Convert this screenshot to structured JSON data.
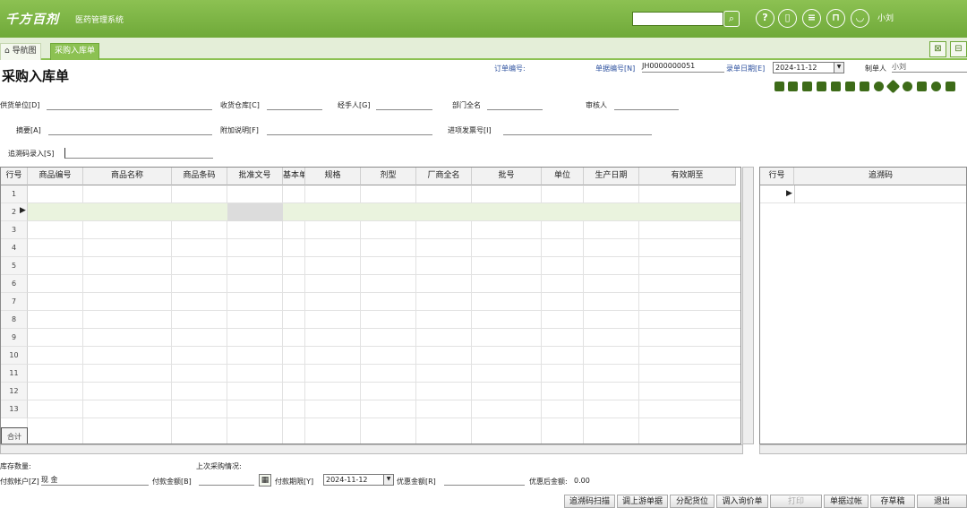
{
  "header": {
    "logo_text": "千方百剂",
    "app_name": "医药管理系统",
    "search_value": "",
    "user_name": "小刘",
    "icons": [
      "help-icon",
      "device-icon",
      "document-icon",
      "lock-icon",
      "user-icon"
    ]
  },
  "tabs": [
    {
      "label": "导航图",
      "icon": "home-icon"
    },
    {
      "label": "采购入库单",
      "active": true
    }
  ],
  "form": {
    "title": "采购入库单",
    "order_no_label": "订单编号:",
    "doc_no_label": "单据编号[N]",
    "doc_no_value": "JH0000000051",
    "entry_date_label": "录单日期[E]",
    "entry_date_value": "2024-11-12",
    "maker_label": "制单人",
    "maker_value": "小刘",
    "supplier_label": "供货单位[D]",
    "warehouse_label": "收货仓库[C]",
    "handler_label": "经手人[G]",
    "dept_label": "部门全名",
    "auditor_label": "审核人",
    "summary_label": "摘要[A]",
    "extra_label": "附加说明[F]",
    "invoice_label": "进项发票号[I]",
    "trace_label": "追溯码录入[S]"
  },
  "grid": {
    "columns": [
      "行号",
      "商品编号",
      "商品名称",
      "商品条码",
      "批准文号",
      "基本单",
      "规格",
      "剂型",
      "厂商全名",
      "批号",
      "单位",
      "生产日期",
      "有效期至"
    ],
    "rows": [
      "1",
      "2",
      "3",
      "4",
      "5",
      "6",
      "7",
      "8",
      "9",
      "10",
      "11",
      "12",
      "13"
    ],
    "total_label": "合计",
    "current_row": "2"
  },
  "trace_grid": {
    "columns": [
      "行号",
      "追溯码"
    ]
  },
  "footer": {
    "stock_qty_label": "库存数量:",
    "last_purchase_label": "上次采购情况:",
    "pay_account_label": "付款帐户[Z]",
    "pay_account_value": "现  金",
    "pay_amount_label": "付款金额[B]",
    "pay_deadline_label": "付款期限[Y]",
    "pay_deadline_value": "2024-11-12",
    "discount_label": "优惠金额[R]",
    "after_discount_label": "优惠后金额:",
    "after_discount_value": "0.00"
  },
  "buttons": [
    {
      "label": "追溯码扫描",
      "enabled": true
    },
    {
      "label": "调上游单据",
      "enabled": true
    },
    {
      "label": "分配货位",
      "enabled": true
    },
    {
      "label": "调入询价单",
      "enabled": true
    },
    {
      "label": "打印",
      "enabled": false
    },
    {
      "label": "单据过帐",
      "enabled": true
    },
    {
      "label": "存草稿",
      "enabled": true
    },
    {
      "label": "退出",
      "enabled": true
    }
  ]
}
